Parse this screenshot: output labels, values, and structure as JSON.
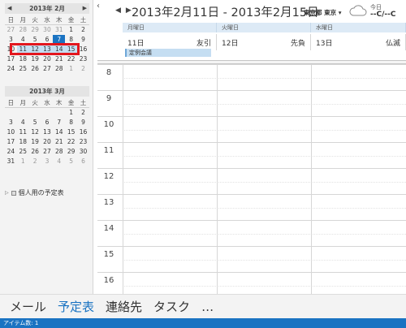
{
  "calendar1": {
    "title": "2013年 2月",
    "weekdays": [
      "日",
      "月",
      "火",
      "水",
      "木",
      "金",
      "土"
    ],
    "weeks": [
      [
        "27",
        "28",
        "29",
        "30",
        "31",
        "1",
        "2"
      ],
      [
        "3",
        "4",
        "5",
        "6",
        "7",
        "8",
        "9"
      ],
      [
        "10",
        "11",
        "12",
        "13",
        "14",
        "15",
        "16"
      ],
      [
        "17",
        "18",
        "19",
        "20",
        "21",
        "22",
        "23"
      ],
      [
        "24",
        "25",
        "26",
        "27",
        "28",
        "1",
        "2"
      ]
    ]
  },
  "calendar2": {
    "title": "2013年 3月",
    "weekdays": [
      "日",
      "月",
      "火",
      "水",
      "木",
      "金",
      "土"
    ],
    "weeks": [
      [
        "",
        "",
        "",
        "",
        "",
        "1",
        "2"
      ],
      [
        "3",
        "4",
        "5",
        "6",
        "7",
        "8",
        "9"
      ],
      [
        "10",
        "11",
        "12",
        "13",
        "14",
        "15",
        "16"
      ],
      [
        "17",
        "18",
        "19",
        "20",
        "21",
        "22",
        "23"
      ],
      [
        "24",
        "25",
        "26",
        "27",
        "28",
        "29",
        "30"
      ],
      [
        "31",
        "1",
        "2",
        "3",
        "4",
        "5",
        "6"
      ]
    ]
  },
  "folder": {
    "label": "個人用の予定表"
  },
  "header": {
    "date_range": "2013年2月11日 - 2013年2月15日",
    "location": "東京都 東京",
    "weather_label": "今日",
    "weather_temp": "--C/--C"
  },
  "days": [
    {
      "weekday": "月曜日",
      "date": "11日",
      "rokuyo": "友引"
    },
    {
      "weekday": "火曜日",
      "date": "12日",
      "rokuyo": "先負"
    },
    {
      "weekday": "水曜日",
      "date": "13日",
      "rokuyo": "仏滅"
    }
  ],
  "event": {
    "title": "定例会議"
  },
  "hours": [
    "8",
    "9",
    "10",
    "11",
    "12",
    "13",
    "14",
    "15",
    "16"
  ],
  "nav": {
    "mail": "メール",
    "calendar": "予定表",
    "people": "連絡先",
    "tasks": "タスク",
    "more": "…"
  },
  "status": {
    "text": "アイテム数: 1"
  },
  "colors": {
    "accent": "#1a73c2",
    "selection_box": "#e3161e",
    "event_bg": "#c5def2"
  }
}
